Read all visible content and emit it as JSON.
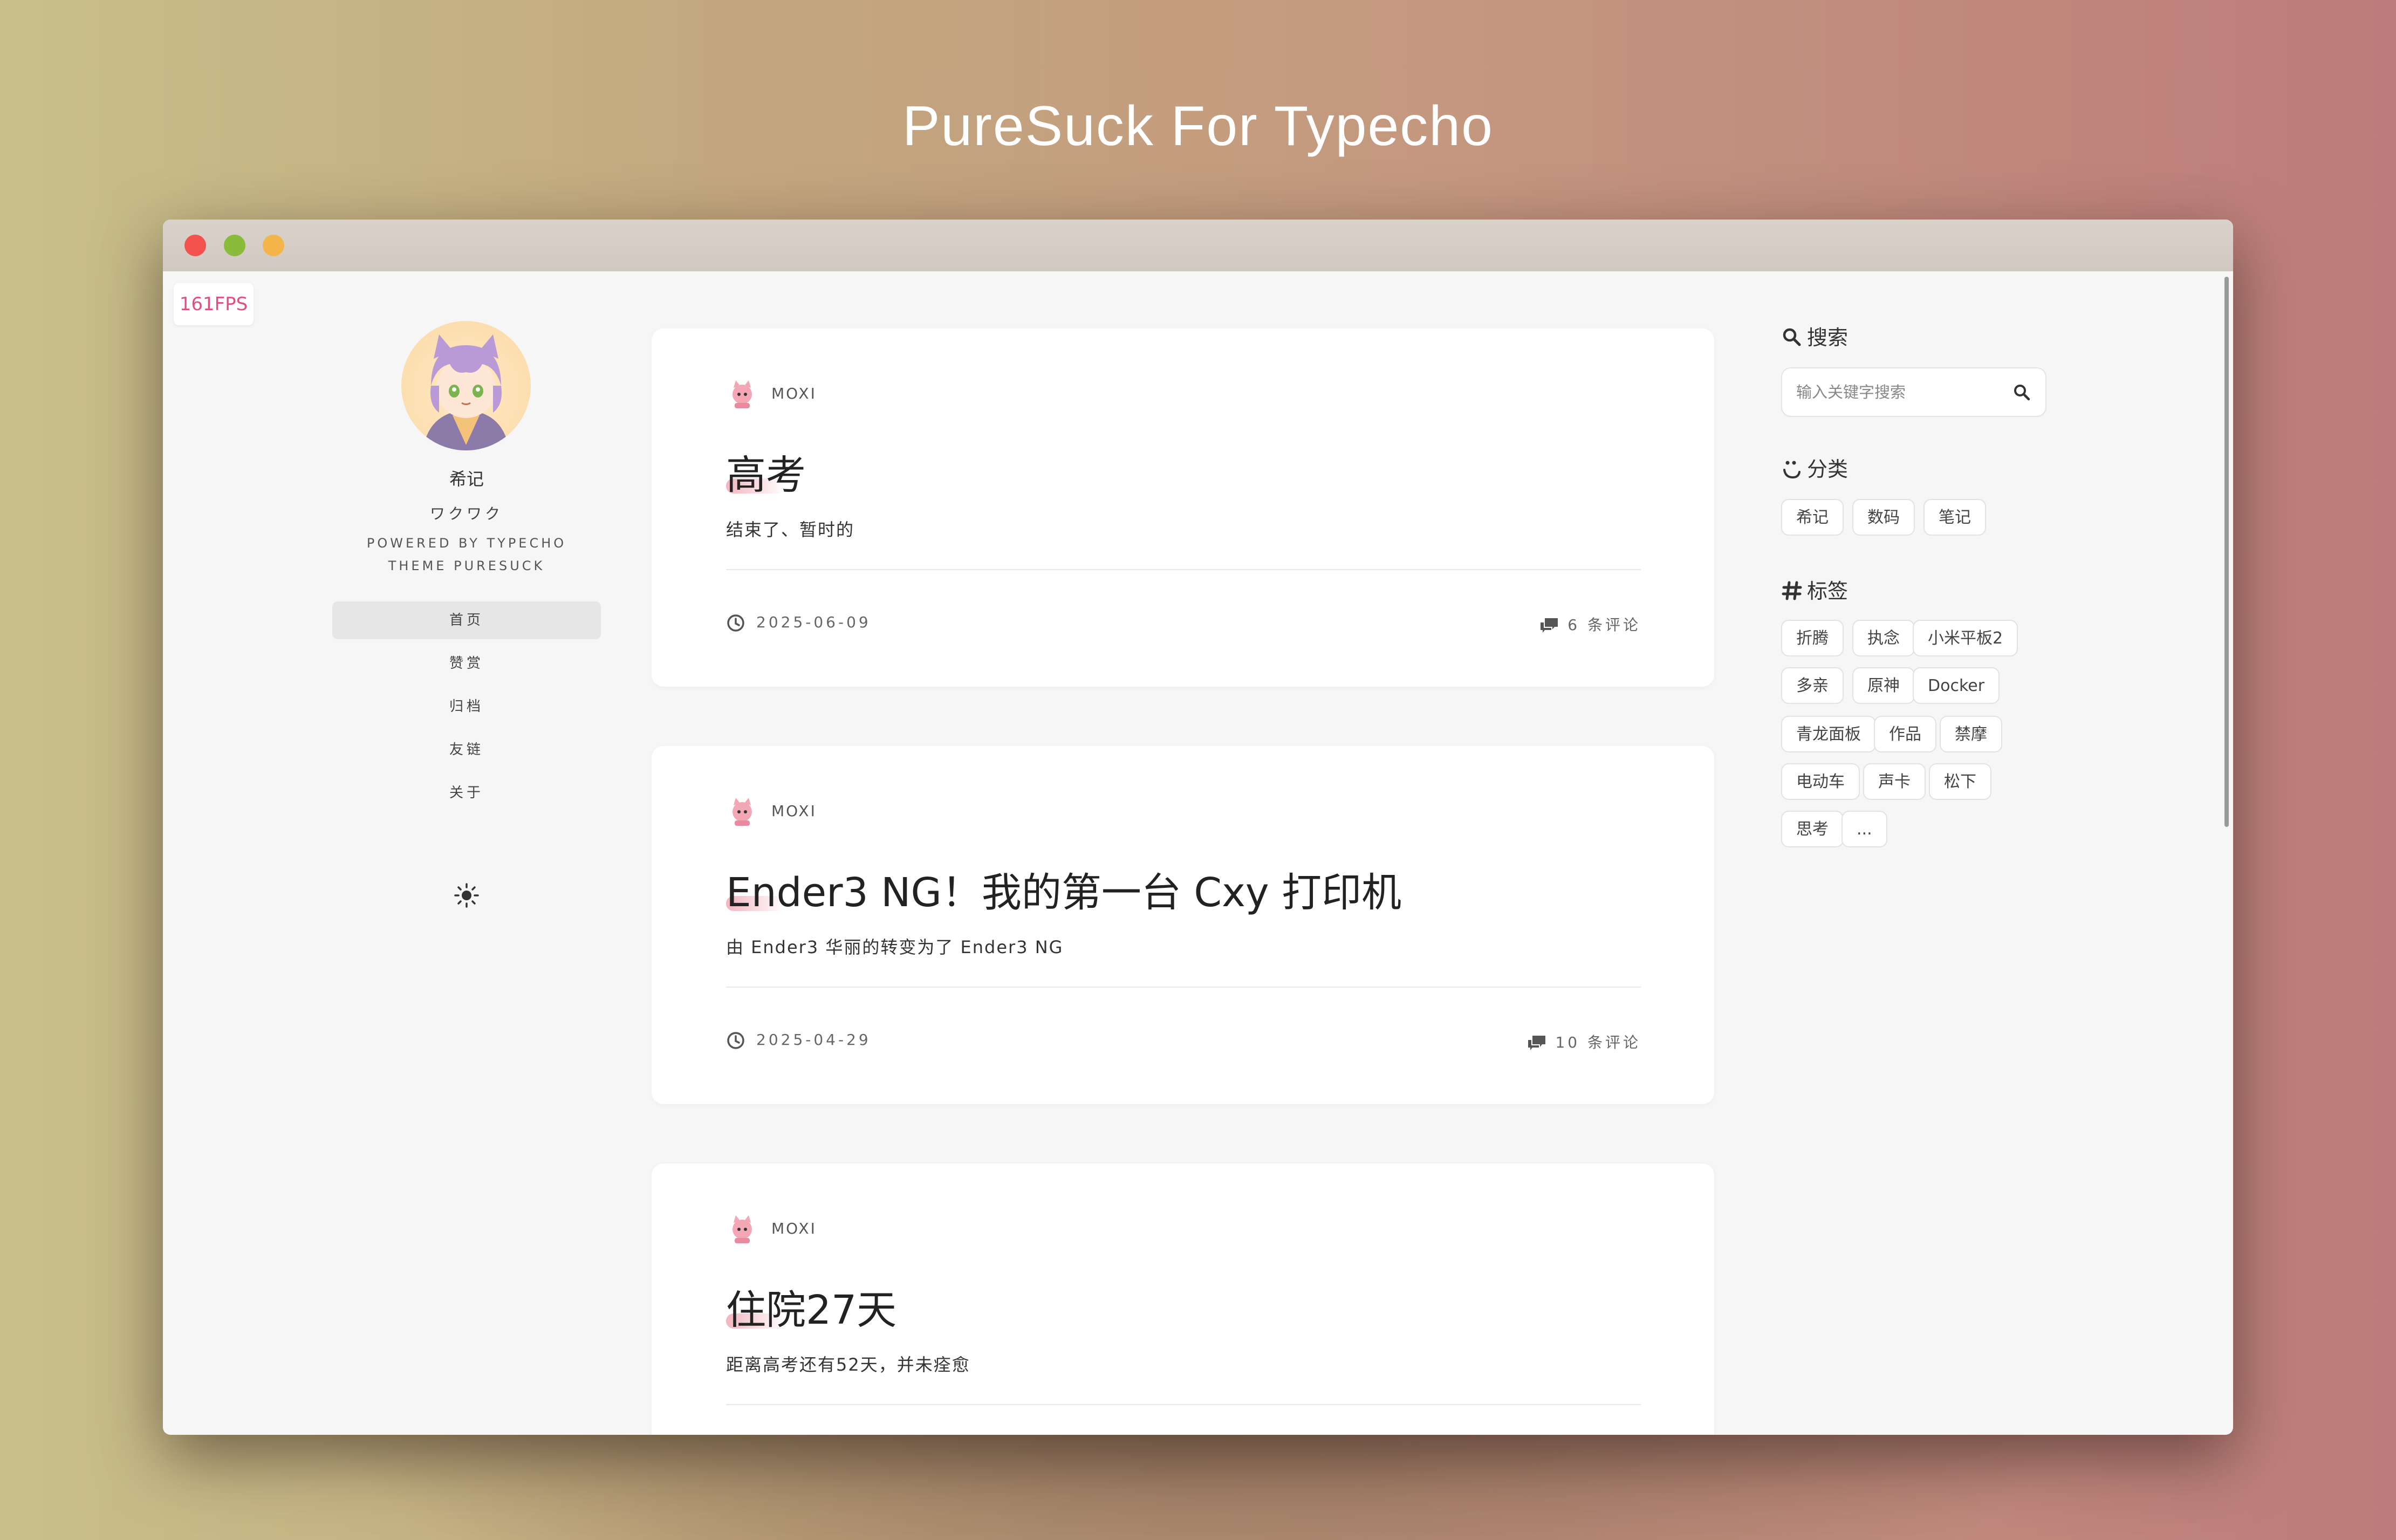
{
  "hero": {
    "title": "PureSuck For Typecho"
  },
  "window": {
    "fps": "161FPS",
    "colors": {
      "accent": "#e04f84",
      "close": "#f2514d",
      "minimize": "#8abb3b",
      "maximize": "#f3b54a"
    }
  },
  "sidebar": {
    "site_name": "希记",
    "motto": "ワクワク",
    "powered": "POWERED BY TYPECHO",
    "theme": "THEME PURESUCK",
    "nav": [
      {
        "label": "首页"
      },
      {
        "label": "赞赏"
      },
      {
        "label": "归档"
      },
      {
        "label": "友链"
      },
      {
        "label": "关于"
      }
    ],
    "theme_toggle_icon": "sun-icon"
  },
  "posts": [
    {
      "author": "MOXI",
      "title": "高考",
      "excerpt": "结束了、暂时的",
      "date": "2025-06-09",
      "comments": "6 条评论"
    },
    {
      "author": "MOXI",
      "title": "Ender3 NG！我的第一台 Cxy 打印机",
      "excerpt": "由 Ender3 华丽的转变为了 Ender3 NG",
      "date": "2025-04-29",
      "comments": "10 条评论"
    },
    {
      "author": "MOXI",
      "title": "住院27天",
      "excerpt": "距离高考还有52天，并未痊愈"
    }
  ],
  "widgets": {
    "search": {
      "title": "搜索",
      "placeholder": "输入关键字搜索"
    },
    "categories": {
      "title": "分类",
      "items": [
        "希记",
        "数码",
        "笔记"
      ]
    },
    "tags": {
      "title": "标签",
      "items": [
        "折腾",
        "执念",
        "小米平板2",
        "多亲",
        "原神",
        "Docker",
        "青龙面板",
        "作品",
        "禁摩",
        "电动车",
        "声卡",
        "松下",
        "思考",
        "..."
      ]
    }
  }
}
